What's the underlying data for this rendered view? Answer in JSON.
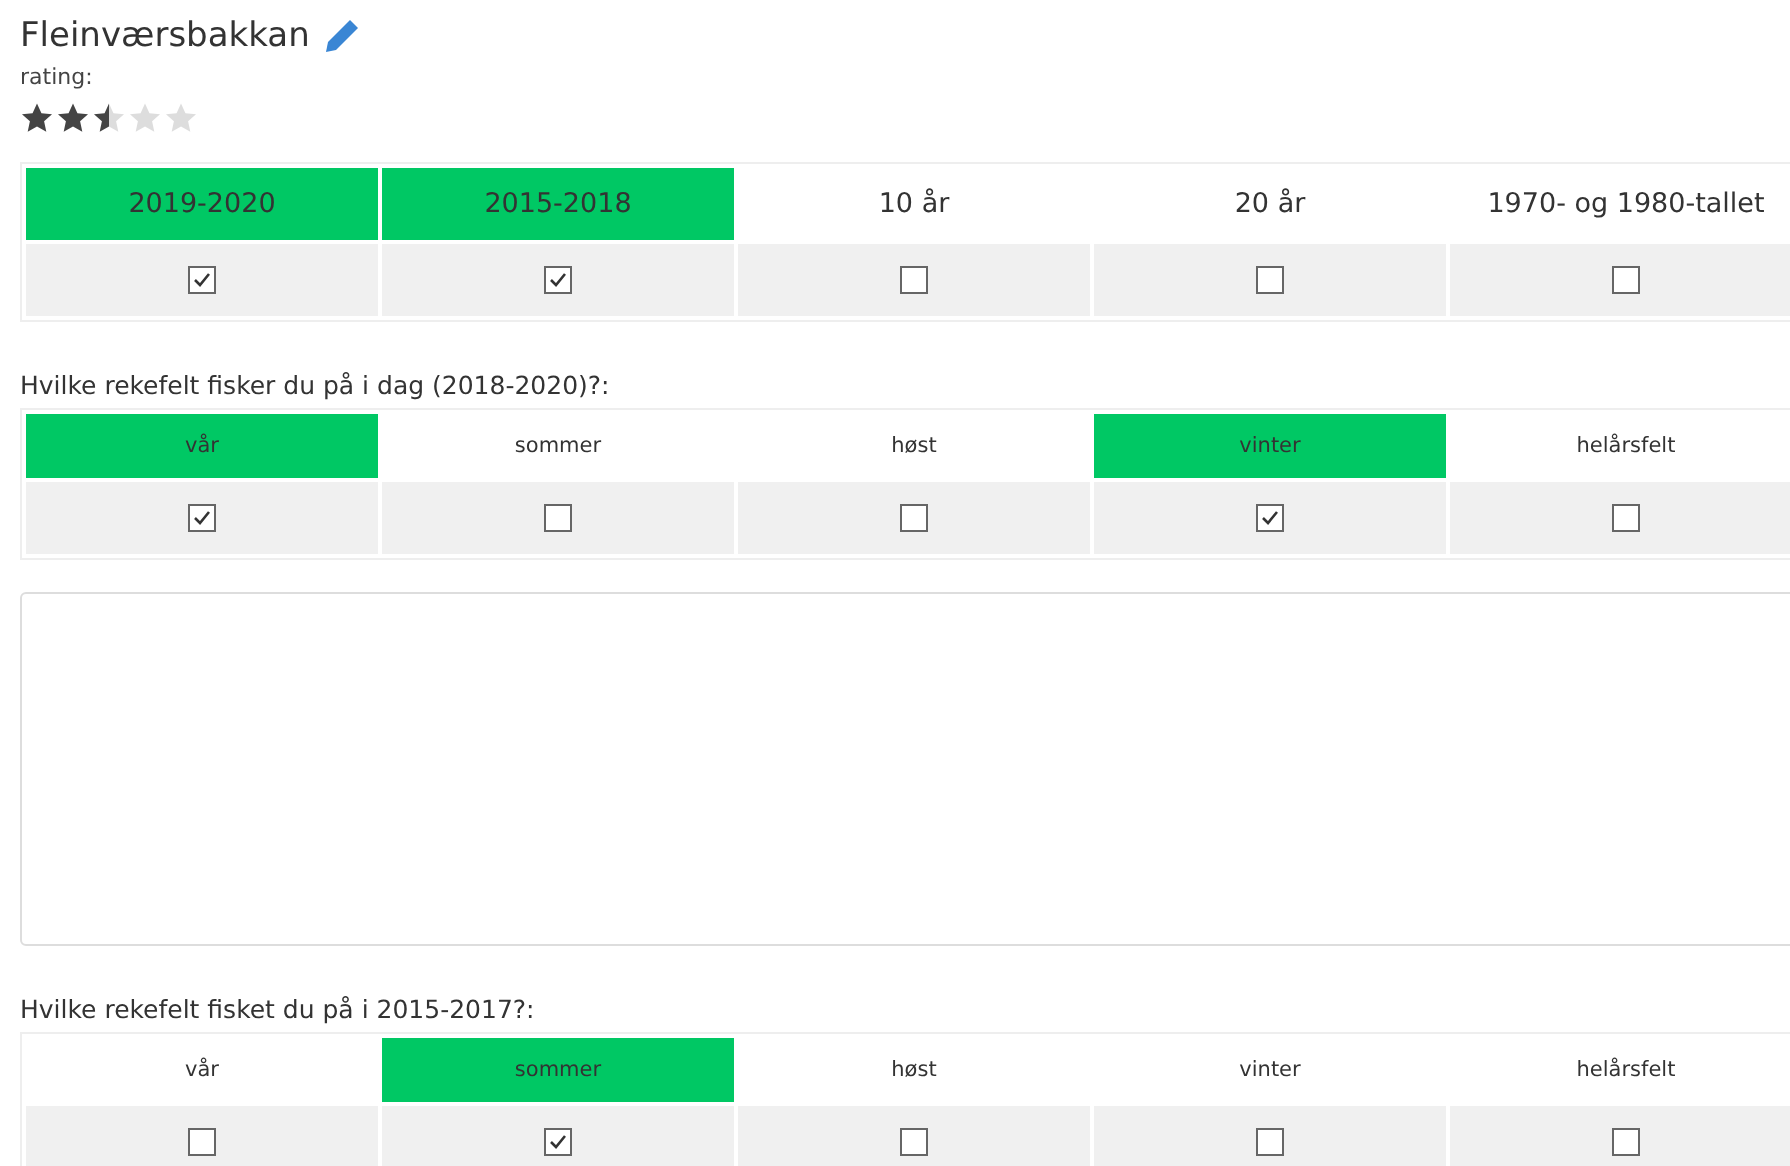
{
  "title": "Fleinværsbakkan",
  "rating": {
    "label": "rating:",
    "stars": 2.5
  },
  "sections": [
    {
      "kind": "wide",
      "columns": [
        {
          "label": "2019-2020",
          "selected": true,
          "checked": true
        },
        {
          "label": "2015-2018",
          "selected": true,
          "checked": true
        },
        {
          "label": "10 år",
          "selected": false,
          "checked": false
        },
        {
          "label": "20 år",
          "selected": false,
          "checked": false
        },
        {
          "label": "1970- og 1980-tallet",
          "selected": false,
          "checked": false
        }
      ]
    },
    {
      "kind": "compact",
      "question": "Hvilke rekefelt fisker du på i dag (2018-2020)?:",
      "columns": [
        {
          "label": "vår",
          "selected": true,
          "checked": true
        },
        {
          "label": "sommer",
          "selected": false,
          "checked": false
        },
        {
          "label": "høst",
          "selected": false,
          "checked": false
        },
        {
          "label": "vinter",
          "selected": true,
          "checked": true
        },
        {
          "label": "helårsfelt",
          "selected": false,
          "checked": false
        }
      ]
    },
    {
      "kind": "comment"
    },
    {
      "kind": "compact",
      "question": "Hvilke rekefelt fisket du på i 2015-2017?:",
      "columns": [
        {
          "label": "vår",
          "selected": false,
          "checked": false
        },
        {
          "label": "sommer",
          "selected": true,
          "checked": true
        },
        {
          "label": "høst",
          "selected": false,
          "checked": false
        },
        {
          "label": "vinter",
          "selected": false,
          "checked": false
        },
        {
          "label": "helårsfelt",
          "selected": false,
          "checked": false
        }
      ]
    }
  ]
}
